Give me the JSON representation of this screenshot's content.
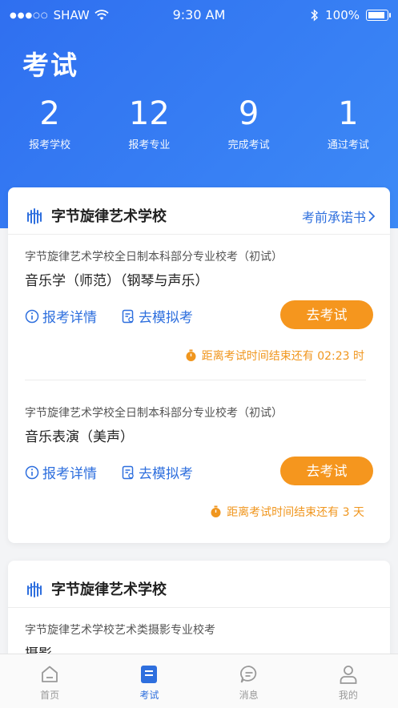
{
  "status_bar": {
    "carrier": "SHAW",
    "time": "9:30 AM",
    "battery": "100%"
  },
  "header": {
    "title": "考试",
    "stats": [
      {
        "value": "2",
        "label": "报考学校"
      },
      {
        "value": "12",
        "label": "报考专业"
      },
      {
        "value": "9",
        "label": "完成考试"
      },
      {
        "value": "1",
        "label": "通过考试"
      }
    ]
  },
  "card1": {
    "school": "字节旋律艺术学校",
    "pledge_label": "考前承诺书",
    "exams": [
      {
        "sub": "字节旋律艺术学校全日制本科部分专业校考（初试）",
        "major": "音乐学（师范）（钢琴与声乐）",
        "details": "报考详情",
        "mock": "去模拟考",
        "go": "去考试",
        "timer": "距离考试时间结束还有 02:23 时"
      },
      {
        "sub": "字节旋律艺术学校全日制本科部分专业校考（初试）",
        "major": "音乐表演（美声）",
        "details": "报考详情",
        "mock": "去模拟考",
        "go": "去考试",
        "timer": "距离考试时间结束还有 3 天"
      }
    ]
  },
  "card2": {
    "school": "字节旋律艺术学校",
    "sub": "字节旋律艺术学校艺术类摄影专业校考",
    "major": "摄影"
  },
  "tabbar": [
    {
      "label": "首页",
      "icon": "home-icon"
    },
    {
      "label": "考试",
      "icon": "exam-icon"
    },
    {
      "label": "消息",
      "icon": "message-icon"
    },
    {
      "label": "我的",
      "icon": "profile-icon"
    }
  ],
  "colors": {
    "primary": "#2e6fde",
    "accent": "#f5961e"
  }
}
